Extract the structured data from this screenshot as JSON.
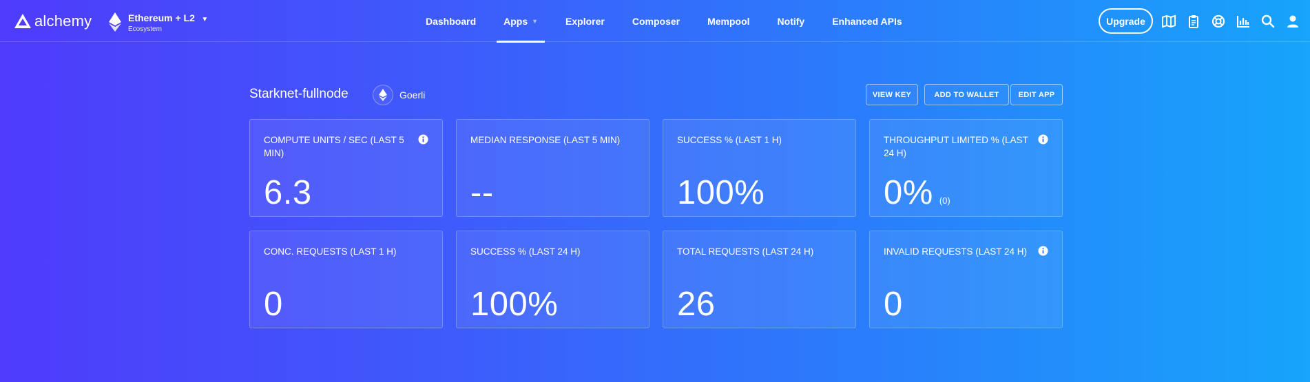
{
  "brand": {
    "name": "alchemy"
  },
  "network": {
    "name": "Ethereum + L2",
    "subtitle": "Ecosystem"
  },
  "nav": {
    "items": [
      {
        "label": "Dashboard"
      },
      {
        "label": "Apps"
      },
      {
        "label": "Explorer"
      },
      {
        "label": "Composer"
      },
      {
        "label": "Mempool"
      },
      {
        "label": "Notify"
      },
      {
        "label": "Enhanced APIs"
      }
    ],
    "active": "Apps"
  },
  "header_tools": {
    "upgrade_label": "Upgrade",
    "icons": [
      "map-icon",
      "clipboard-icon",
      "support-icon",
      "chart-icon",
      "search-icon",
      "user-icon"
    ]
  },
  "app": {
    "name": "Starknet-fullnode",
    "network_label": "Goerli",
    "actions": {
      "view_key": "VIEW KEY",
      "add_to_wallet": "ADD TO WALLET",
      "edit_app": "EDIT APP"
    }
  },
  "stats": [
    {
      "title": "COMPUTE UNITS / SEC (LAST 5 MIN)",
      "value": "6.3",
      "sub": "",
      "info": true
    },
    {
      "title": "MEDIAN RESPONSE (LAST 5 MIN)",
      "value": "--",
      "sub": "",
      "info": false
    },
    {
      "title": "SUCCESS % (LAST 1 H)",
      "value": "100%",
      "sub": "",
      "info": false
    },
    {
      "title": "THROUGHPUT LIMITED % (LAST 24 H)",
      "value": "0%",
      "sub": "(0)",
      "info": true
    },
    {
      "title": "CONC. REQUESTS (LAST 1 H)",
      "value": "0",
      "sub": "",
      "info": false
    },
    {
      "title": "SUCCESS % (LAST 24 H)",
      "value": "100%",
      "sub": "",
      "info": false
    },
    {
      "title": "TOTAL REQUESTS (LAST 24 H)",
      "value": "26",
      "sub": "",
      "info": false
    },
    {
      "title": "INVALID REQUESTS (LAST 24 H)",
      "value": "0",
      "sub": "",
      "info": true
    }
  ],
  "colors": {
    "gradient_start": "#4f3bfb",
    "gradient_end": "#17a4fb",
    "text": "#ffffff"
  }
}
